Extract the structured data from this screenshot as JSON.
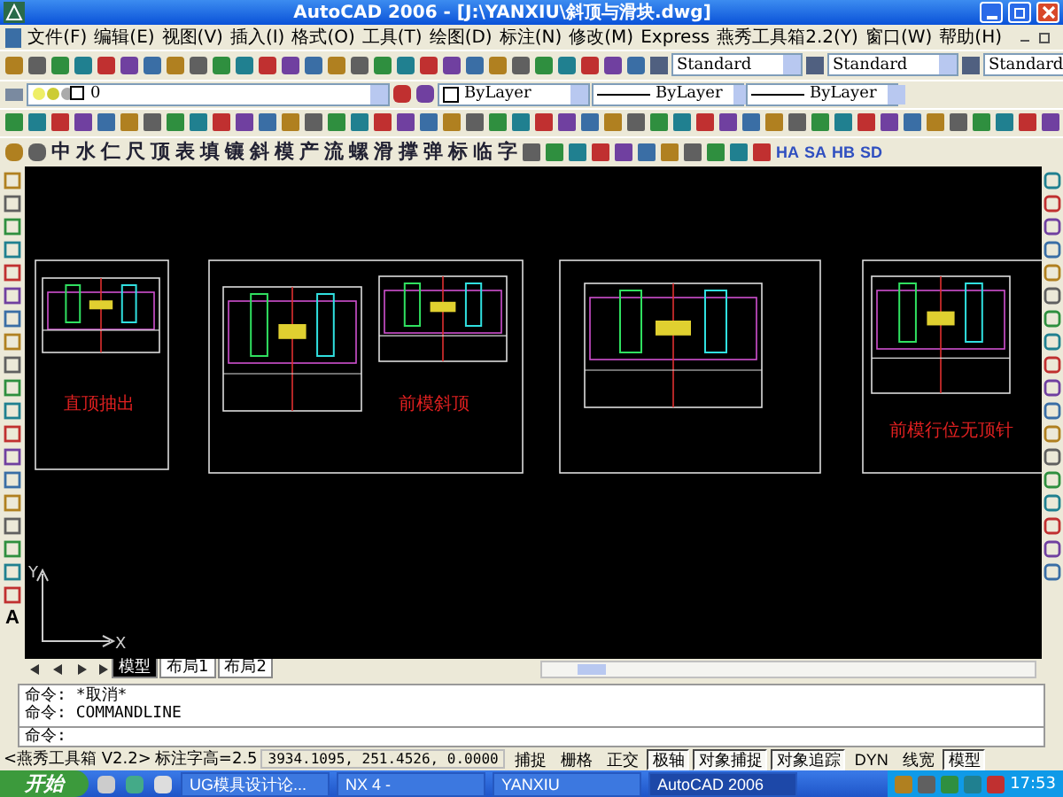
{
  "window": {
    "title": "AutoCAD 2006 - [J:\\YANXIU\\斜顶与滑块.dwg]"
  },
  "menu": [
    "文件(F)",
    "编辑(E)",
    "视图(V)",
    "插入(I)",
    "格式(O)",
    "工具(T)",
    "绘图(D)",
    "标注(N)",
    "修改(M)",
    "Express",
    "燕秀工具箱2.2(Y)",
    "窗口(W)",
    "帮助(H)"
  ],
  "style_dropdowns": [
    "Standard",
    "Standard",
    "Standard"
  ],
  "layer": {
    "value": "0"
  },
  "property_dropdowns": [
    "ByLayer",
    "ByLayer",
    "ByLayer"
  ],
  "char_toolbar": [
    "中",
    "水",
    "仁",
    "尺",
    "顶",
    "表",
    "填",
    "镶",
    "斜",
    "模",
    "产",
    "流",
    "螺",
    "滑",
    "撑",
    "弹",
    "标",
    "临",
    "字"
  ],
  "text_toolbar": [
    "HA",
    "SA",
    "HB",
    "SD"
  ],
  "text_tool": "A",
  "drawing_labels": [
    "直顶抽出",
    "前模斜顶",
    "前模行位无顶针"
  ],
  "axis_labels": [
    "Y",
    "X"
  ],
  "layout_tabs": [
    {
      "label": "模型",
      "selected": true
    },
    {
      "label": "布局1",
      "selected": false
    },
    {
      "label": "布局2",
      "selected": false
    }
  ],
  "command_history": [
    {
      "prompt": "命令:",
      "text": "*取消*"
    },
    {
      "prompt": "命令:",
      "text": "COMMANDLINE"
    }
  ],
  "command_prompt": "命令:",
  "status_bar": {
    "toolbox": "<燕秀工具箱 V2.2>",
    "text_height": "标注字高=2.5",
    "coordinates": "3934.1095, 251.4526, 0.0000",
    "toggles": [
      {
        "label": "捕捉",
        "on": false
      },
      {
        "label": "栅格",
        "on": false
      },
      {
        "label": "正交",
        "on": false
      },
      {
        "label": "极轴",
        "on": true
      },
      {
        "label": "对象捕捉",
        "on": true
      },
      {
        "label": "对象追踪",
        "on": true
      },
      {
        "label": "DYN",
        "on": false
      },
      {
        "label": "线宽",
        "on": false
      },
      {
        "label": "模型",
        "on": true
      }
    ]
  },
  "taskbar": {
    "start": "开始",
    "tasks": [
      {
        "label": "UG模具设计论...",
        "selected": false
      },
      {
        "label": "NX 4 -",
        "selected": false
      },
      {
        "label": "YANXIU",
        "selected": false
      },
      {
        "label": "AutoCAD 2006",
        "selected": true
      }
    ],
    "clock": "17:53"
  }
}
